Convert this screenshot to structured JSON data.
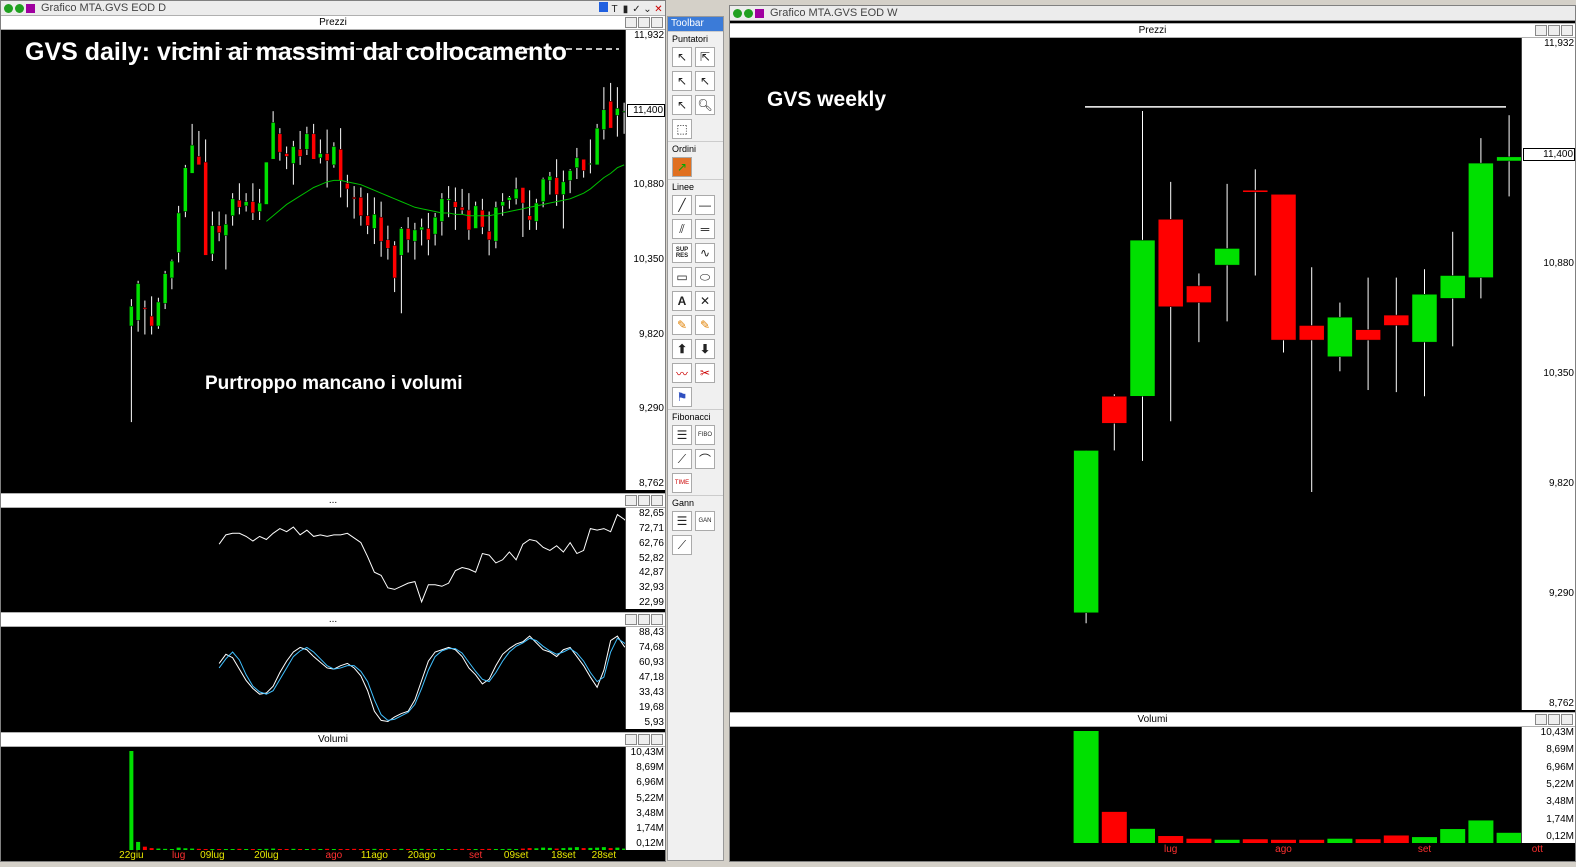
{
  "windows": {
    "daily_title": "Grafico MTA.GVS EOD D",
    "weekly_title": "Grafico MTA.GVS EOD W"
  },
  "panels": {
    "prices": "Prezzi",
    "ind1": "...",
    "ind2": "...",
    "volumes": "Volumi"
  },
  "annotations": {
    "daily_title": "GVS daily: vicini ai massimi dal collocamento",
    "daily_note": "Purtroppo mancano i volumi",
    "weekly_title": "GVS weekly"
  },
  "toolbar": {
    "title": "Toolbar",
    "sections": [
      "Puntatori",
      "Ordini",
      "Linee",
      "Fibonacci",
      "Gann"
    ],
    "icon_labels": {
      "supres": "SUP RES",
      "fibo": "FIBO",
      "time": "TIME",
      "gann": "GAN"
    }
  },
  "colors": {
    "up": "#00e000",
    "down": "#ff0000",
    "ma": "#00c000",
    "bg": "#000000"
  },
  "chart_data": [
    {
      "type": "candlestick",
      "title": "Prezzi",
      "timeframe": "daily",
      "ylim": [
        8.762,
        11.932
      ],
      "yticks": [
        "11,932",
        "11,400",
        "10,880",
        "10,350",
        "9,820",
        "9,290",
        "8,762"
      ],
      "last_price": "11,400",
      "resistance_level": 11.84,
      "xticks": [
        {
          "label": "22giu",
          "i": 0,
          "color": "yellow"
        },
        {
          "label": "lug",
          "i": 7,
          "color": "red"
        },
        {
          "label": "09lug",
          "i": 12,
          "color": "yellow"
        },
        {
          "label": "20lug",
          "i": 20,
          "color": "yellow"
        },
        {
          "label": "ago",
          "i": 30,
          "color": "red"
        },
        {
          "label": "11ago",
          "i": 36,
          "color": "yellow"
        },
        {
          "label": "20ago",
          "i": 43,
          "color": "yellow"
        },
        {
          "label": "set",
          "i": 51,
          "color": "red"
        },
        {
          "label": "09set",
          "i": 57,
          "color": "yellow"
        },
        {
          "label": "18set",
          "i": 64,
          "color": "yellow"
        },
        {
          "label": "28set",
          "i": 70,
          "color": "yellow"
        }
      ],
      "ohlc": [
        [
          9.88,
          10.07,
          9.2,
          10.02
        ],
        [
          9.92,
          10.2,
          9.84,
          10.18
        ],
        [
          10.01,
          10.06,
          9.82,
          10.0
        ],
        [
          9.95,
          10.09,
          9.82,
          9.88
        ],
        [
          9.88,
          10.08,
          9.86,
          10.05
        ],
        [
          10.04,
          10.27,
          10.0,
          10.25
        ],
        [
          10.22,
          10.35,
          10.14,
          10.34
        ],
        [
          10.4,
          10.73,
          10.33,
          10.68
        ],
        [
          10.69,
          11.02,
          10.65,
          11.0
        ],
        [
          10.96,
          11.31,
          10.98,
          11.16
        ],
        [
          11.08,
          11.26,
          11.05,
          11.02
        ],
        [
          11.04,
          11.2,
          10.55,
          10.38
        ],
        [
          10.39,
          10.69,
          10.34,
          10.59
        ],
        [
          10.59,
          10.69,
          10.48,
          10.54
        ],
        [
          10.52,
          10.67,
          10.28,
          10.6
        ],
        [
          10.66,
          10.82,
          10.59,
          10.78
        ],
        [
          10.77,
          10.89,
          10.67,
          10.72
        ],
        [
          10.73,
          10.82,
          10.69,
          10.76
        ],
        [
          10.76,
          10.89,
          10.63,
          10.68
        ],
        [
          10.69,
          10.85,
          10.63,
          10.75
        ],
        [
          10.74,
          11.03,
          10.91,
          11.04
        ],
        [
          11.06,
          11.4,
          11.08,
          11.32
        ],
        [
          11.24,
          11.28,
          11.05,
          11.11
        ],
        [
          11.1,
          11.15,
          10.99,
          11.08
        ],
        [
          11.03,
          11.19,
          10.88,
          11.15
        ],
        [
          11.13,
          11.26,
          11.02,
          11.08
        ],
        [
          11.13,
          11.29,
          11.09,
          11.24
        ],
        [
          11.24,
          11.31,
          11.1,
          11.06
        ],
        [
          11.07,
          11.2,
          11.03,
          11.1
        ],
        [
          11.1,
          11.27,
          10.86,
          11.05
        ],
        [
          11.02,
          11.18,
          11.0,
          11.15
        ],
        [
          11.13,
          11.28,
          10.79,
          10.91
        ],
        [
          10.89,
          10.95,
          10.72,
          10.85
        ],
        [
          10.79,
          10.87,
          10.64,
          10.78
        ],
        [
          10.79,
          10.86,
          10.59,
          10.66
        ],
        [
          10.66,
          10.82,
          10.53,
          10.59
        ],
        [
          10.57,
          10.79,
          10.46,
          10.67
        ],
        [
          10.65,
          10.76,
          10.37,
          10.48
        ],
        [
          10.49,
          10.59,
          10.35,
          10.43
        ],
        [
          10.45,
          10.48,
          10.12,
          10.22
        ],
        [
          10.38,
          10.58,
          9.97,
          10.57
        ],
        [
          10.57,
          10.65,
          10.4,
          10.49
        ],
        [
          10.48,
          10.61,
          10.35,
          10.56
        ],
        [
          10.56,
          10.64,
          10.45,
          10.58
        ],
        [
          10.57,
          10.68,
          10.38,
          10.49
        ],
        [
          10.53,
          10.68,
          10.45,
          10.65
        ],
        [
          10.62,
          10.82,
          10.52,
          10.78
        ],
        [
          10.77,
          10.87,
          10.65,
          10.78
        ],
        [
          10.76,
          10.86,
          10.56,
          10.72
        ],
        [
          10.72,
          10.85,
          10.67,
          10.7
        ],
        [
          10.7,
          10.82,
          10.49,
          10.56
        ],
        [
          10.57,
          10.76,
          10.58,
          10.73
        ],
        [
          10.7,
          10.78,
          10.53,
          10.58
        ],
        [
          10.55,
          10.69,
          10.38,
          10.49
        ],
        [
          10.48,
          10.76,
          10.43,
          10.72
        ],
        [
          10.73,
          10.82,
          10.66,
          10.76
        ],
        [
          10.77,
          10.8,
          10.71,
          10.79
        ],
        [
          10.78,
          10.93,
          10.74,
          10.85
        ],
        [
          10.86,
          10.85,
          10.51,
          10.75
        ],
        [
          10.66,
          10.84,
          10.56,
          10.63
        ],
        [
          10.62,
          10.78,
          10.56,
          10.75
        ],
        [
          10.76,
          10.93,
          10.72,
          10.92
        ],
        [
          10.91,
          10.97,
          10.81,
          10.94
        ],
        [
          10.93,
          11.06,
          10.73,
          10.81
        ],
        [
          10.81,
          10.98,
          10.57,
          10.9
        ],
        [
          10.91,
          10.99,
          10.82,
          10.98
        ],
        [
          11.0,
          11.14,
          10.92,
          11.07
        ],
        [
          11.06,
          11.05,
          10.93,
          10.98
        ],
        [
          11.03,
          11.2,
          10.96,
          11.03
        ],
        [
          11.02,
          11.31,
          11.15,
          11.28
        ],
        [
          11.27,
          11.57,
          11.2,
          11.41
        ],
        [
          11.47,
          11.6,
          11.36,
          11.28
        ],
        [
          11.37,
          11.57,
          11.22,
          11.42
        ],
        [
          11.4,
          11.46,
          11.24,
          11.4
        ]
      ],
      "ma": [
        null,
        null,
        null,
        null,
        null,
        null,
        null,
        null,
        null,
        null,
        null,
        null,
        null,
        null,
        null,
        null,
        null,
        null,
        null,
        null,
        10.62,
        10.66,
        10.7,
        10.74,
        10.77,
        10.8,
        10.83,
        10.86,
        10.88,
        10.9,
        10.91,
        10.91,
        10.9,
        10.89,
        10.88,
        10.86,
        10.84,
        10.82,
        10.8,
        10.78,
        10.76,
        10.74,
        10.72,
        10.71,
        10.7,
        10.69,
        10.68,
        10.68,
        10.67,
        10.67,
        10.66,
        10.66,
        10.66,
        10.66,
        10.67,
        10.68,
        10.69,
        10.7,
        10.71,
        10.72,
        10.73,
        10.74,
        10.75,
        10.76,
        10.77,
        10.78,
        10.8,
        10.82,
        10.85,
        10.89,
        10.93,
        10.96,
        11.0,
        11.02
      ],
      "ma_start_index": 20
    },
    {
      "type": "line",
      "timeframe": "daily",
      "yticks": [
        "82,65",
        "72,71",
        "62,76",
        "52,82",
        "42,87",
        "32,93",
        "22,99"
      ],
      "ylim": [
        22.99,
        82.65
      ],
      "start_index": 13,
      "values": [
        62,
        68,
        69,
        69,
        67,
        64,
        67,
        65,
        69,
        72,
        70,
        73,
        68,
        71,
        67,
        68,
        67,
        68,
        68,
        69,
        66,
        63,
        54,
        44,
        42,
        34,
        33,
        35,
        37,
        38,
        25,
        36,
        36,
        35,
        37,
        45,
        47,
        46,
        44,
        56,
        55,
        50,
        52,
        57,
        52,
        62,
        65,
        64,
        60,
        58,
        61,
        57,
        63,
        56,
        58,
        72,
        71,
        72,
        70,
        81,
        78,
        74,
        75
      ],
      "color": "#ffffff"
    },
    {
      "type": "line",
      "timeframe": "daily",
      "yticks": [
        "88,43",
        "74,68",
        "60,93",
        "47,18",
        "33,43",
        "19,68",
        "5,93"
      ],
      "ylim": [
        5.93,
        88.43
      ],
      "start_index": 13,
      "series": [
        {
          "color": "#ffffff",
          "values": [
            60,
            68,
            65,
            55,
            45,
            38,
            33,
            34,
            40,
            52,
            62,
            70,
            74,
            72,
            66,
            61,
            56,
            55,
            58,
            60,
            56,
            49,
            36,
            18,
            10,
            9,
            13,
            16,
            18,
            28,
            45,
            62,
            70,
            72,
            74,
            72,
            66,
            56,
            50,
            42,
            46,
            58,
            68,
            73,
            77,
            79,
            84,
            78,
            72,
            70,
            66,
            72,
            74,
            66,
            58,
            48,
            39,
            54,
            80,
            84,
            75,
            70,
            72
          ]
        },
        {
          "color": "#40c0ff",
          "values": [
            56,
            64,
            70,
            63,
            50,
            40,
            35,
            33,
            36,
            46,
            56,
            66,
            71,
            74,
            70,
            64,
            58,
            55,
            56,
            58,
            58,
            53,
            44,
            28,
            15,
            10,
            11,
            14,
            17,
            24,
            38,
            54,
            66,
            71,
            73,
            73,
            69,
            61,
            53,
            46,
            44,
            52,
            62,
            70,
            75,
            78,
            82,
            80,
            75,
            71,
            68,
            70,
            73,
            69,
            62,
            52,
            44,
            48,
            70,
            82,
            78,
            73,
            71
          ]
        }
      ]
    },
    {
      "type": "bar",
      "title": "Volumi",
      "timeframe": "daily",
      "yticks": [
        "10,43M",
        "8,69M",
        "6,96M",
        "5,22M",
        "3,48M",
        "1,74M",
        "0,12M"
      ],
      "ylim": [
        0,
        10.43
      ],
      "values": [
        10.43,
        0.85,
        0.35,
        0.2,
        0.15,
        0.12,
        0.1,
        0.25,
        0.18,
        0.15,
        0.12,
        0.1,
        0.1,
        0.08,
        0.1,
        0.1,
        0.12,
        0.1,
        0.1,
        0.1,
        0.12,
        0.15,
        0.1,
        0.1,
        0.12,
        0.1,
        0.1,
        0.12,
        0.1,
        0.12,
        0.1,
        0.1,
        0.1,
        0.12,
        0.08,
        0.1,
        0.12,
        0.1,
        0.1,
        0.1,
        0.12,
        0.1,
        0.1,
        0.12,
        0.1,
        0.1,
        0.1,
        0.1,
        0.1,
        0.12,
        0.1,
        0.1,
        0.1,
        0.12,
        0.1,
        0.1,
        0.12,
        0.1,
        0.15,
        0.2,
        0.18,
        0.25,
        0.22,
        0.15,
        0.2,
        0.25,
        0.3,
        0.2,
        0.22,
        0.25,
        0.3,
        0.2,
        0.25,
        0.15
      ],
      "last_label": "0,12M"
    },
    {
      "type": "candlestick",
      "title": "Prezzi",
      "timeframe": "weekly",
      "ylim": [
        8.762,
        11.932
      ],
      "yticks": [
        "11,932",
        "11,400",
        "10,880",
        "10,350",
        "9,820",
        "9,290",
        "8,762"
      ],
      "last_price": "11,400",
      "resistance_level": 11.63,
      "xticks": [
        {
          "label": "lug",
          "i": 3,
          "color": "red"
        },
        {
          "label": "ago",
          "i": 7,
          "color": "red"
        },
        {
          "label": "set",
          "i": 12,
          "color": "red"
        },
        {
          "label": "ott",
          "i": 16,
          "color": "red"
        }
      ],
      "ohlc": [
        [
          9.2,
          9.98,
          9.15,
          9.98
        ],
        [
          10.24,
          10.25,
          9.98,
          10.11
        ],
        [
          10.24,
          11.61,
          9.93,
          10.99
        ],
        [
          11.09,
          11.27,
          10.12,
          10.67
        ],
        [
          10.77,
          10.83,
          10.5,
          10.69
        ],
        [
          10.87,
          11.26,
          10.6,
          10.95
        ],
        [
          11.23,
          11.33,
          10.82,
          11.22
        ],
        [
          11.21,
          11.21,
          10.45,
          10.51
        ],
        [
          10.58,
          10.86,
          9.78,
          10.51
        ],
        [
          10.43,
          10.69,
          10.36,
          10.62
        ],
        [
          10.56,
          10.81,
          10.27,
          10.51
        ],
        [
          10.63,
          10.81,
          10.26,
          10.58
        ],
        [
          10.5,
          10.85,
          10.24,
          10.73
        ],
        [
          10.71,
          11.03,
          10.48,
          10.82
        ],
        [
          10.81,
          11.48,
          10.71,
          11.36
        ],
        [
          11.37,
          11.59,
          11.2,
          11.39
        ]
      ],
      "ohlc_note": "weekly candles drawn left-to-right"
    },
    {
      "type": "bar",
      "title": "Volumi",
      "timeframe": "weekly",
      "yticks": [
        "10,43M",
        "8,69M",
        "6,96M",
        "5,22M",
        "3,48M",
        "1,74M",
        "0,12M"
      ],
      "ylim": [
        0,
        10.43
      ],
      "values": [
        10.43,
        2.9,
        1.32,
        0.65,
        0.4,
        0.3,
        0.35,
        0.3,
        0.3,
        0.4,
        0.35,
        0.7,
        0.55,
        1.3,
        2.1,
        0.95,
        0.12
      ],
      "last_label": "0,12M"
    }
  ]
}
